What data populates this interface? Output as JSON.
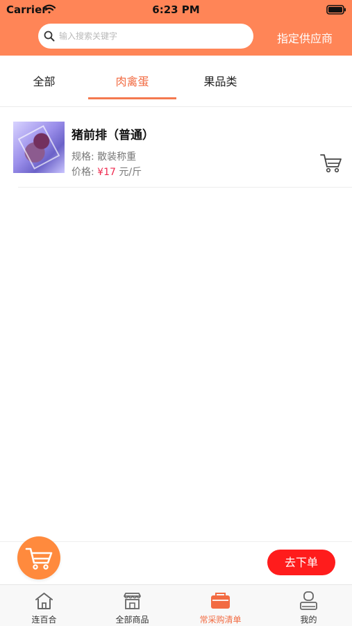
{
  "status_bar": {
    "carrier": "Carrier",
    "time": "6:23 PM"
  },
  "header": {
    "search_placeholder": "输入搜索关键字",
    "supplier_label": "指定供应商",
    "accent_color": "#ff8557"
  },
  "category_tabs": [
    {
      "label": "全部",
      "active": false
    },
    {
      "label": "肉禽蛋",
      "active": true
    },
    {
      "label": "果品类",
      "active": false
    }
  ],
  "products": [
    {
      "name": "猪前排（普通）",
      "spec_label": "规格:",
      "spec_value": "散装称重",
      "price_label": "价格:",
      "price_value": "¥17",
      "price_unit": "元/斤",
      "image_icon": "pork-rib-thumbnail",
      "cart_icon": "cart-icon"
    }
  ],
  "actions": {
    "order_label": "去下单",
    "order_color": "#ff1c1c",
    "cart_fab_color": "#ff8a3d"
  },
  "bottom_tabs": [
    {
      "label": "连百合",
      "icon": "home-icon",
      "active": false
    },
    {
      "label": "全部商品",
      "icon": "store-icon",
      "active": false
    },
    {
      "label": "常采购清单",
      "icon": "purchase-list-icon",
      "active": true
    },
    {
      "label": "我的",
      "icon": "profile-icon",
      "active": false
    }
  ]
}
